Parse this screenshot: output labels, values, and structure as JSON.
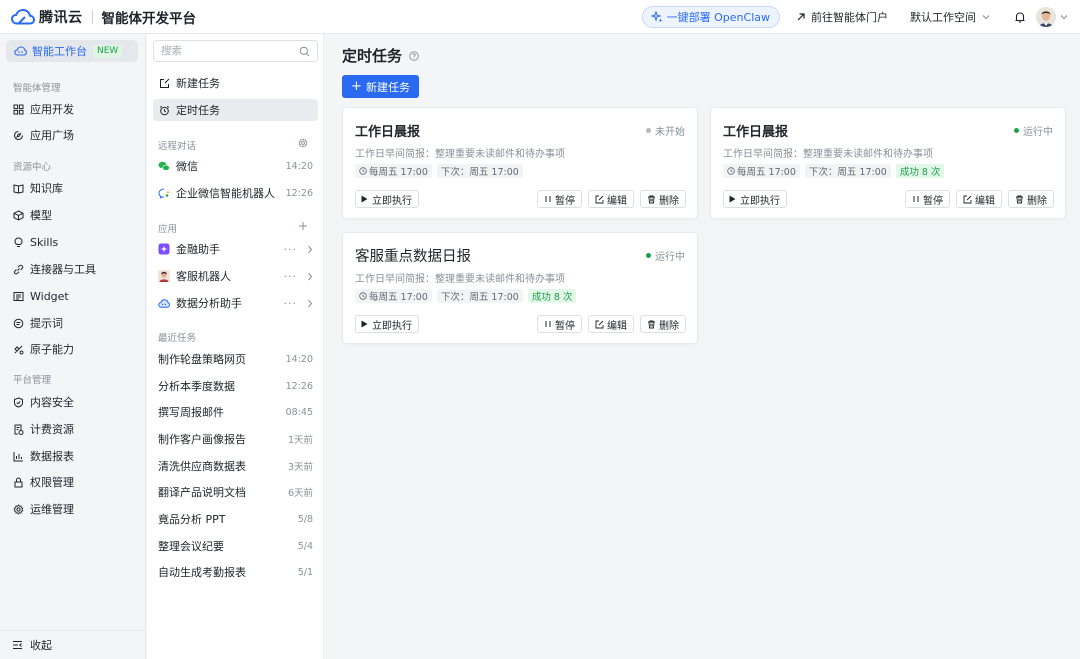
{
  "header": {
    "brand": "腾讯云",
    "platform_title": "智能体开发平台",
    "deploy_label": "一键部署 OpenClaw",
    "portal_link": "前往智能体门户",
    "workspace": "默认工作空间",
    "accent_color": "#2a6af2"
  },
  "sidebar": {
    "active": {
      "label": "智能工作台",
      "badge": "NEW"
    },
    "sections": [
      {
        "title": "智能体管理",
        "items": [
          {
            "label": "应用开发",
            "icon": "grid-icon"
          },
          {
            "label": "应用广场",
            "icon": "compass-icon"
          }
        ]
      },
      {
        "title": "资源中心",
        "items": [
          {
            "label": "知识库",
            "icon": "book-icon"
          },
          {
            "label": "模型",
            "icon": "cube-icon"
          },
          {
            "label": "Skills",
            "icon": "bulb-icon"
          },
          {
            "label": "连接器与工具",
            "icon": "link-icon"
          },
          {
            "label": "Widget",
            "icon": "widget-icon"
          },
          {
            "label": "提示词",
            "icon": "prompt-icon"
          },
          {
            "label": "原子能力",
            "icon": "atom-icon"
          }
        ]
      },
      {
        "title": "平台管理",
        "items": [
          {
            "label": "内容安全",
            "icon": "shield-icon"
          },
          {
            "label": "计费资源",
            "icon": "bill-icon"
          },
          {
            "label": "数据报表",
            "icon": "chart-icon"
          },
          {
            "label": "权限管理",
            "icon": "lock-icon"
          },
          {
            "label": "运维管理",
            "icon": "gear-icon"
          }
        ]
      }
    ],
    "collapse_label": "收起"
  },
  "panel": {
    "search_placeholder": "搜索",
    "new_task": "新建任务",
    "scheduled_task": "定时任务",
    "remote_section": "远程对话",
    "remote": [
      {
        "label": "微信",
        "time": "14:20"
      },
      {
        "label": "企业微信智能机器人",
        "time": "12:26"
      }
    ],
    "apps_section": "应用",
    "apps": [
      {
        "label": "金融助手"
      },
      {
        "label": "客服机器人"
      },
      {
        "label": "数据分析助手"
      }
    ],
    "recent_section": "最近任务",
    "recent": [
      {
        "label": "制作轮盘策略网页",
        "time": "14:20"
      },
      {
        "label": "分析本季度数据",
        "time": "12:26"
      },
      {
        "label": "撰写周报邮件",
        "time": "08:45"
      },
      {
        "label": "制作客户画像报告",
        "time": "1天前"
      },
      {
        "label": "清洗供应商数据表",
        "time": "3天前"
      },
      {
        "label": "翻译产品说明文档",
        "time": "6天前"
      },
      {
        "label": "竟品分析 PPT",
        "time": "5/8"
      },
      {
        "label": "整理会议纪要",
        "time": "5/4"
      },
      {
        "label": "自动生成考勤报表",
        "time": "5/1"
      }
    ]
  },
  "main": {
    "title": "定时任务",
    "new_task_button": "新建任务",
    "cards": [
      {
        "title": "工作日晨报",
        "status": "未开始",
        "status_color": "#b4b8bf",
        "desc": "工作日早间简报：整理重要未读邮件和待办事项",
        "schedule": "每周五 17:00",
        "next": "下次：周五 17:00",
        "success": "",
        "run": "立即执行",
        "pause": "暂停",
        "edit": "编辑",
        "delete": "删除"
      },
      {
        "title": "工作日晨报",
        "status": "运行中",
        "status_color": "#1ea04a",
        "desc": "工作日早间简报：整理重要未读邮件和待办事项",
        "schedule": "每周五 17:00",
        "next": "下次：周五 17:00",
        "success": "成功 8 次",
        "run": "立即执行",
        "pause": "暂停",
        "edit": "编辑",
        "delete": "删除"
      },
      {
        "title": "客服重点数据日报",
        "status": "运行中",
        "status_color": "#1ea04a",
        "desc": "工作日早间简报：整理重要未读邮件和待办事项",
        "schedule": "每周五 17:00",
        "next": "下次：周五 17:00",
        "success": "成功 8 次",
        "run": "立即执行",
        "pause": "暂停",
        "edit": "编辑",
        "delete": "删除"
      }
    ]
  }
}
